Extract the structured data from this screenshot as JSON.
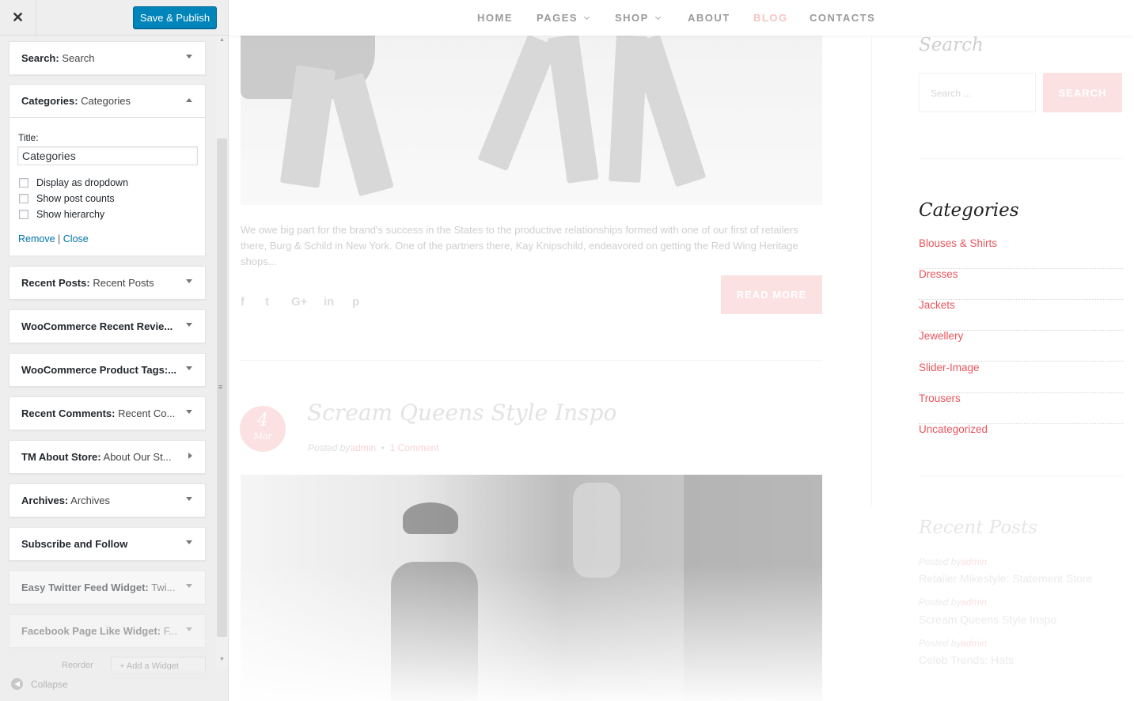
{
  "customizer": {
    "close_icon": "✕",
    "publish_label": "Save & Publish",
    "widgets": [
      {
        "type": "Search:",
        "title": "Search"
      },
      {
        "type": "Categories:",
        "title": "Categories"
      },
      {
        "type": "Recent Posts:",
        "title": "Recent Posts"
      },
      {
        "type": "WooCommerce Recent Revie...",
        "title": ""
      },
      {
        "type": "WooCommerce Product Tags:...",
        "title": ""
      },
      {
        "type": "Recent Comments:",
        "title": "Recent Co..."
      },
      {
        "type": "TM About Store:",
        "title": "About Our St..."
      },
      {
        "type": "Archives:",
        "title": "Archives"
      },
      {
        "type": "Subscribe and Follow",
        "title": ""
      },
      {
        "type": "Easy Twitter Feed Widget:",
        "title": "Twi..."
      },
      {
        "type": "Facebook Page Like Widget:",
        "title": "F..."
      }
    ],
    "categories_form": {
      "title_label": "Title:",
      "title_value": "Categories",
      "checkboxes": [
        "Display as dropdown",
        "Show post counts",
        "Show hierarchy"
      ],
      "remove_label": "Remove",
      "separator": "|",
      "close_label": "Close"
    },
    "reorder_label": "Reorder",
    "add_widget_label": "Add a Widget",
    "collapse_label": "Collapse"
  },
  "preview": {
    "nav": [
      "HOME",
      "PAGES",
      "SHOP",
      "ABOUT",
      "BLOG",
      "CONTACTS"
    ],
    "active_nav": "BLOG",
    "post1": {
      "excerpt": "We owe big part for the brand's success in the States to the productive relationships formed with one of our first of retailers there, Burg & Schild in New York. One of the partners there, Kay Knipschild, endeavored on getting the Red Wing Heritage shops...",
      "read_more": "READ MORE",
      "social_icons": [
        "f",
        "t",
        "G+",
        "in",
        "p"
      ]
    },
    "post2": {
      "day": "4",
      "month": "Mar",
      "title": "Scream Queens Style Inspo",
      "posted_by": "Posted by",
      "author": "admin",
      "bullet": "•",
      "comments": "1 Comment"
    },
    "sidebar": {
      "search_heading": "Search",
      "search_placeholder": "Search ...",
      "search_button": "SEARCH",
      "categories_heading": "Categories",
      "categories": [
        "Blouses & Shirts",
        "Dresses",
        "Jackets",
        "Jewellery",
        "Slider-Image",
        "Trousers",
        "Uncategorized"
      ],
      "recent_posts_heading": "Recent Posts",
      "recent_posts": [
        {
          "posted_by": "Posted by",
          "author": "admin",
          "title": "Retailer Mikestyle: Statement Store"
        },
        {
          "posted_by": "Posted by",
          "author": "admin",
          "title": "Scream Queens Style Inspo"
        },
        {
          "posted_by": "Posted by",
          "author": "admin",
          "title": "Celeb Trends: Hats"
        }
      ]
    }
  },
  "colors": {
    "publish_blue": "#0085ba",
    "link_blue": "#0073aa",
    "category_red": "#e8565c",
    "accent_pink": "#fbe1e1"
  }
}
